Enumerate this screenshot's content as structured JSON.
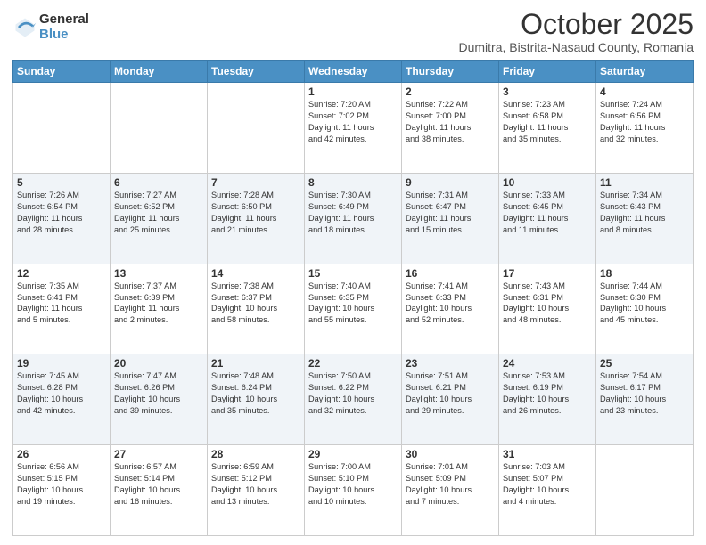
{
  "logo": {
    "general": "General",
    "blue": "Blue"
  },
  "header": {
    "title": "October 2025",
    "subtitle": "Dumitra, Bistrita-Nasaud County, Romania"
  },
  "weekdays": [
    "Sunday",
    "Monday",
    "Tuesday",
    "Wednesday",
    "Thursday",
    "Friday",
    "Saturday"
  ],
  "weeks": [
    [
      {
        "day": "",
        "info": ""
      },
      {
        "day": "",
        "info": ""
      },
      {
        "day": "",
        "info": ""
      },
      {
        "day": "1",
        "info": "Sunrise: 7:20 AM\nSunset: 7:02 PM\nDaylight: 11 hours\nand 42 minutes."
      },
      {
        "day": "2",
        "info": "Sunrise: 7:22 AM\nSunset: 7:00 PM\nDaylight: 11 hours\nand 38 minutes."
      },
      {
        "day": "3",
        "info": "Sunrise: 7:23 AM\nSunset: 6:58 PM\nDaylight: 11 hours\nand 35 minutes."
      },
      {
        "day": "4",
        "info": "Sunrise: 7:24 AM\nSunset: 6:56 PM\nDaylight: 11 hours\nand 32 minutes."
      }
    ],
    [
      {
        "day": "5",
        "info": "Sunrise: 7:26 AM\nSunset: 6:54 PM\nDaylight: 11 hours\nand 28 minutes."
      },
      {
        "day": "6",
        "info": "Sunrise: 7:27 AM\nSunset: 6:52 PM\nDaylight: 11 hours\nand 25 minutes."
      },
      {
        "day": "7",
        "info": "Sunrise: 7:28 AM\nSunset: 6:50 PM\nDaylight: 11 hours\nand 21 minutes."
      },
      {
        "day": "8",
        "info": "Sunrise: 7:30 AM\nSunset: 6:49 PM\nDaylight: 11 hours\nand 18 minutes."
      },
      {
        "day": "9",
        "info": "Sunrise: 7:31 AM\nSunset: 6:47 PM\nDaylight: 11 hours\nand 15 minutes."
      },
      {
        "day": "10",
        "info": "Sunrise: 7:33 AM\nSunset: 6:45 PM\nDaylight: 11 hours\nand 11 minutes."
      },
      {
        "day": "11",
        "info": "Sunrise: 7:34 AM\nSunset: 6:43 PM\nDaylight: 11 hours\nand 8 minutes."
      }
    ],
    [
      {
        "day": "12",
        "info": "Sunrise: 7:35 AM\nSunset: 6:41 PM\nDaylight: 11 hours\nand 5 minutes."
      },
      {
        "day": "13",
        "info": "Sunrise: 7:37 AM\nSunset: 6:39 PM\nDaylight: 11 hours\nand 2 minutes."
      },
      {
        "day": "14",
        "info": "Sunrise: 7:38 AM\nSunset: 6:37 PM\nDaylight: 10 hours\nand 58 minutes."
      },
      {
        "day": "15",
        "info": "Sunrise: 7:40 AM\nSunset: 6:35 PM\nDaylight: 10 hours\nand 55 minutes."
      },
      {
        "day": "16",
        "info": "Sunrise: 7:41 AM\nSunset: 6:33 PM\nDaylight: 10 hours\nand 52 minutes."
      },
      {
        "day": "17",
        "info": "Sunrise: 7:43 AM\nSunset: 6:31 PM\nDaylight: 10 hours\nand 48 minutes."
      },
      {
        "day": "18",
        "info": "Sunrise: 7:44 AM\nSunset: 6:30 PM\nDaylight: 10 hours\nand 45 minutes."
      }
    ],
    [
      {
        "day": "19",
        "info": "Sunrise: 7:45 AM\nSunset: 6:28 PM\nDaylight: 10 hours\nand 42 minutes."
      },
      {
        "day": "20",
        "info": "Sunrise: 7:47 AM\nSunset: 6:26 PM\nDaylight: 10 hours\nand 39 minutes."
      },
      {
        "day": "21",
        "info": "Sunrise: 7:48 AM\nSunset: 6:24 PM\nDaylight: 10 hours\nand 35 minutes."
      },
      {
        "day": "22",
        "info": "Sunrise: 7:50 AM\nSunset: 6:22 PM\nDaylight: 10 hours\nand 32 minutes."
      },
      {
        "day": "23",
        "info": "Sunrise: 7:51 AM\nSunset: 6:21 PM\nDaylight: 10 hours\nand 29 minutes."
      },
      {
        "day": "24",
        "info": "Sunrise: 7:53 AM\nSunset: 6:19 PM\nDaylight: 10 hours\nand 26 minutes."
      },
      {
        "day": "25",
        "info": "Sunrise: 7:54 AM\nSunset: 6:17 PM\nDaylight: 10 hours\nand 23 minutes."
      }
    ],
    [
      {
        "day": "26",
        "info": "Sunrise: 6:56 AM\nSunset: 5:15 PM\nDaylight: 10 hours\nand 19 minutes."
      },
      {
        "day": "27",
        "info": "Sunrise: 6:57 AM\nSunset: 5:14 PM\nDaylight: 10 hours\nand 16 minutes."
      },
      {
        "day": "28",
        "info": "Sunrise: 6:59 AM\nSunset: 5:12 PM\nDaylight: 10 hours\nand 13 minutes."
      },
      {
        "day": "29",
        "info": "Sunrise: 7:00 AM\nSunset: 5:10 PM\nDaylight: 10 hours\nand 10 minutes."
      },
      {
        "day": "30",
        "info": "Sunrise: 7:01 AM\nSunset: 5:09 PM\nDaylight: 10 hours\nand 7 minutes."
      },
      {
        "day": "31",
        "info": "Sunrise: 7:03 AM\nSunset: 5:07 PM\nDaylight: 10 hours\nand 4 minutes."
      },
      {
        "day": "",
        "info": ""
      }
    ]
  ]
}
